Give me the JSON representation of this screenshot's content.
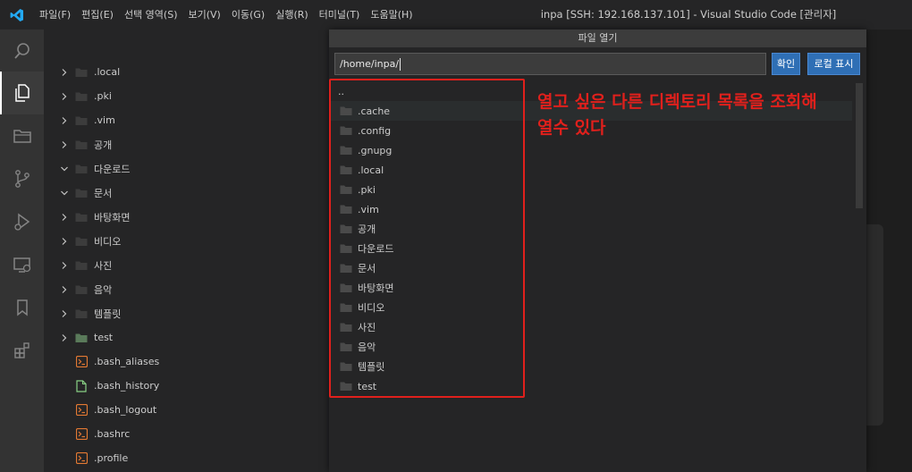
{
  "window_title": "inpa [SSH: 192.168.137.101] - Visual Studio Code [관리자]",
  "menu": [
    {
      "label": "파일(F)"
    },
    {
      "label": "편집(E)"
    },
    {
      "label": "선택 영역(S)"
    },
    {
      "label": "보기(V)"
    },
    {
      "label": "이동(G)"
    },
    {
      "label": "실행(R)"
    },
    {
      "label": "터미널(T)"
    },
    {
      "label": "도움말(H)"
    }
  ],
  "activity_icons": [
    "search-icon",
    "files-icon",
    "folder-icon",
    "source-control-icon",
    "run-debug-icon",
    "remote-explorer-icon",
    "bookmark-icon",
    "extensions-icon"
  ],
  "explorer": {
    "items": [
      {
        "label": ".local",
        "kind": "folder",
        "expanded": false
      },
      {
        "label": ".pki",
        "kind": "folder",
        "expanded": false
      },
      {
        "label": ".vim",
        "kind": "folder",
        "expanded": false
      },
      {
        "label": "공개",
        "kind": "folder",
        "expanded": false
      },
      {
        "label": "다운로드",
        "kind": "folder",
        "expanded": true
      },
      {
        "label": "문서",
        "kind": "folder",
        "expanded": true
      },
      {
        "label": "바탕화면",
        "kind": "folder",
        "expanded": false
      },
      {
        "label": "비디오",
        "kind": "folder",
        "expanded": false
      },
      {
        "label": "사진",
        "kind": "folder",
        "expanded": false
      },
      {
        "label": "음악",
        "kind": "folder",
        "expanded": false
      },
      {
        "label": "템플릿",
        "kind": "folder",
        "expanded": false
      },
      {
        "label": "test",
        "kind": "folder-green",
        "expanded": false
      },
      {
        "label": ".bash_aliases",
        "kind": "shell"
      },
      {
        "label": ".bash_history",
        "kind": "file"
      },
      {
        "label": ".bash_logout",
        "kind": "shell"
      },
      {
        "label": ".bashrc",
        "kind": "shell"
      },
      {
        "label": ".profile",
        "kind": "shell"
      }
    ]
  },
  "dialog": {
    "title": "파일 열기",
    "path_value": "/home/inpa/",
    "ok_label": "확인",
    "local_label": "로컬 표시",
    "entries": [
      {
        "label": "..",
        "icon": false
      },
      {
        "label": ".cache",
        "icon": true,
        "selected": true
      },
      {
        "label": ".config",
        "icon": true
      },
      {
        "label": ".gnupg",
        "icon": true
      },
      {
        "label": ".local",
        "icon": true
      },
      {
        "label": ".pki",
        "icon": true
      },
      {
        "label": ".vim",
        "icon": true
      },
      {
        "label": "공개",
        "icon": true
      },
      {
        "label": "다운로드",
        "icon": true
      },
      {
        "label": "문서",
        "icon": true
      },
      {
        "label": "바탕화면",
        "icon": true
      },
      {
        "label": "비디오",
        "icon": true
      },
      {
        "label": "사진",
        "icon": true
      },
      {
        "label": "음악",
        "icon": true
      },
      {
        "label": "템플릿",
        "icon": true
      },
      {
        "label": "test",
        "icon": true
      }
    ]
  },
  "annotation": {
    "line1": "열고 싶은 다른 디렉토리 목록을 조회해",
    "line2": "열수 있다",
    "color": "#e0201c"
  },
  "colors": {
    "accent_button": "#2f6fb5",
    "folder_icon": "#c09553",
    "shell_icon": "#e37933",
    "vscode_blue": "#23a9f2"
  }
}
